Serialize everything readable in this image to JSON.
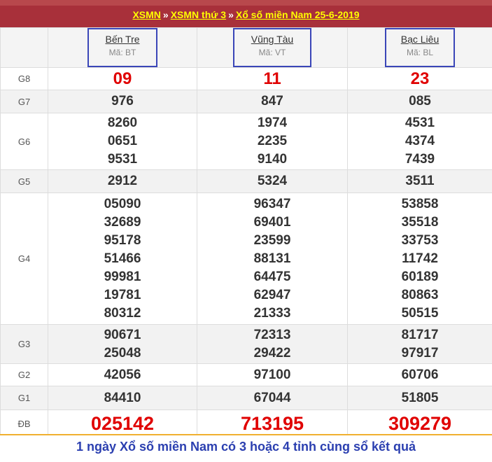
{
  "breadcrumb": {
    "home": "XSMN",
    "sep1": "»",
    "day": "XSMN thứ 3",
    "sep2": "»",
    "current": "Xổ số miền Nam 25-6-2019"
  },
  "provinces": [
    {
      "name": "Bến Tre",
      "code": "Mã: BT"
    },
    {
      "name": "Vũng Tàu",
      "code": "Mã: VT"
    },
    {
      "name": "Bạc Liêu",
      "code": "Mã: BL"
    }
  ],
  "prizes": {
    "G8": {
      "label": "G8",
      "values": [
        [
          "09"
        ],
        [
          "11"
        ],
        [
          "23"
        ]
      ]
    },
    "G7": {
      "label": "G7",
      "values": [
        [
          "976"
        ],
        [
          "847"
        ],
        [
          "085"
        ]
      ]
    },
    "G6": {
      "label": "G6",
      "values": [
        [
          "8260",
          "0651",
          "9531"
        ],
        [
          "1974",
          "2235",
          "9140"
        ],
        [
          "4531",
          "4374",
          "7439"
        ]
      ]
    },
    "G5": {
      "label": "G5",
      "values": [
        [
          "2912"
        ],
        [
          "5324"
        ],
        [
          "3511"
        ]
      ]
    },
    "G4": {
      "label": "G4",
      "values": [
        [
          "05090",
          "32689",
          "95178",
          "51466",
          "99981",
          "19781",
          "80312"
        ],
        [
          "96347",
          "69401",
          "23599",
          "88131",
          "64475",
          "62947",
          "21333"
        ],
        [
          "53858",
          "35518",
          "33753",
          "11742",
          "60189",
          "80863",
          "50515"
        ]
      ]
    },
    "G3": {
      "label": "G3",
      "values": [
        [
          "90671",
          "25048"
        ],
        [
          "72313",
          "29422"
        ],
        [
          "81717",
          "97917"
        ]
      ]
    },
    "G2": {
      "label": "G2",
      "values": [
        [
          "42056"
        ],
        [
          "97100"
        ],
        [
          "60706"
        ]
      ]
    },
    "G1": {
      "label": "G1",
      "values": [
        [
          "84410"
        ],
        [
          "67044"
        ],
        [
          "51805"
        ]
      ]
    },
    "DB": {
      "label": "ĐB",
      "values": [
        [
          "025142"
        ],
        [
          "713195"
        ],
        [
          "309279"
        ]
      ]
    }
  },
  "footer": {
    "text": "1 ngày Xổ số miền Nam có 3 hoặc 4 tỉnh cùng sổ kết quả"
  },
  "colors": {
    "header_bg": "#a8303a",
    "link_yellow": "#ffff00",
    "prize_red": "#e00000",
    "box_blue": "#3a46b8",
    "footer_blue": "#2b3fb0"
  }
}
